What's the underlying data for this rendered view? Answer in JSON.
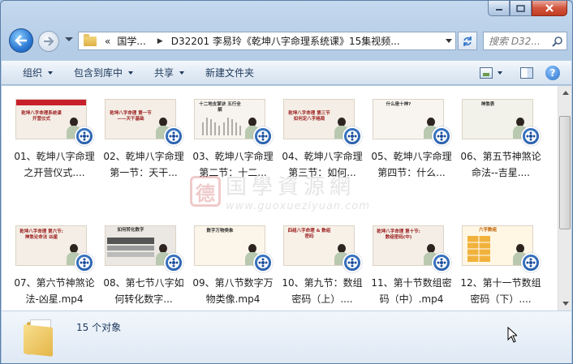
{
  "window": {
    "caption_buttons": [
      "minimize",
      "maximize",
      "close"
    ]
  },
  "address_bar": {
    "overflow": "«",
    "segments": [
      "国学...",
      "D32201 李易玲《乾坤八字命理系统课》15集视频..."
    ]
  },
  "search": {
    "placeholder": "搜索 D32..."
  },
  "toolbar": {
    "organize": "组织",
    "include_in_library": "包含到库中",
    "share": "共享",
    "new_folder": "新建文件夹"
  },
  "watermark": {
    "seal": "德",
    "text": "国學資源網",
    "url": "www.guoxueziyuan.com"
  },
  "files": [
    {
      "label": "01、乾坤八字命理之开营仪式....",
      "thumb_title": "乾坤八字命理系统课 开营仪式",
      "band": "#c8202a"
    },
    {
      "label": "02、乾坤八字命理第一节：天干...",
      "thumb_title": "乾坤八字命理 第一节——天干基础",
      "band": "#f4eee6"
    },
    {
      "label": "03、乾坤八字命理第二节：十二...",
      "thumb_title": "十二地支掌诀 五行全解",
      "band": "#f4eee6"
    },
    {
      "label": "04、乾坤八字命理第三节：如何...",
      "thumb_title": "乾坤八字命理 第三节 如何定八字格局",
      "band": "#f4eee6"
    },
    {
      "label": "05、乾坤八字命理第四节：什么...",
      "thumb_title": "什么是十神?",
      "band": "#f4eee6"
    },
    {
      "label": "06、第五节神煞论命法--吉星....",
      "thumb_title": "神煞表",
      "band": "#f4eee6"
    },
    {
      "label": "07、第六节神煞论法-凶星.mp4",
      "thumb_title": "乾坤八字命理 第六节:神煞论命法 凶星",
      "band": "#f4eee6"
    },
    {
      "label": "08、第七节八字如何转化数字...",
      "thumb_title": "如何转化数字",
      "band": "#f4eee6"
    },
    {
      "label": "09、第八节数字万物类像.mp4",
      "thumb_title": "数字万物类象",
      "band": "#f4eee6"
    },
    {
      "label": "10、第九节：数组密码（上）....",
      "thumb_title": "四组八字命理 & 数组密码",
      "band": "#f4eee6"
    },
    {
      "label": "11、第十节数组密码（中）.mp4",
      "thumb_title": "乾坤八字命理 第十节:数组密码(中)",
      "band": "#f4eee6"
    },
    {
      "label": "12、第十一节数组密码（下）....",
      "thumb_title": "六字数组",
      "band": "#f4eee6"
    }
  ],
  "details": {
    "count": "15 个对象"
  }
}
